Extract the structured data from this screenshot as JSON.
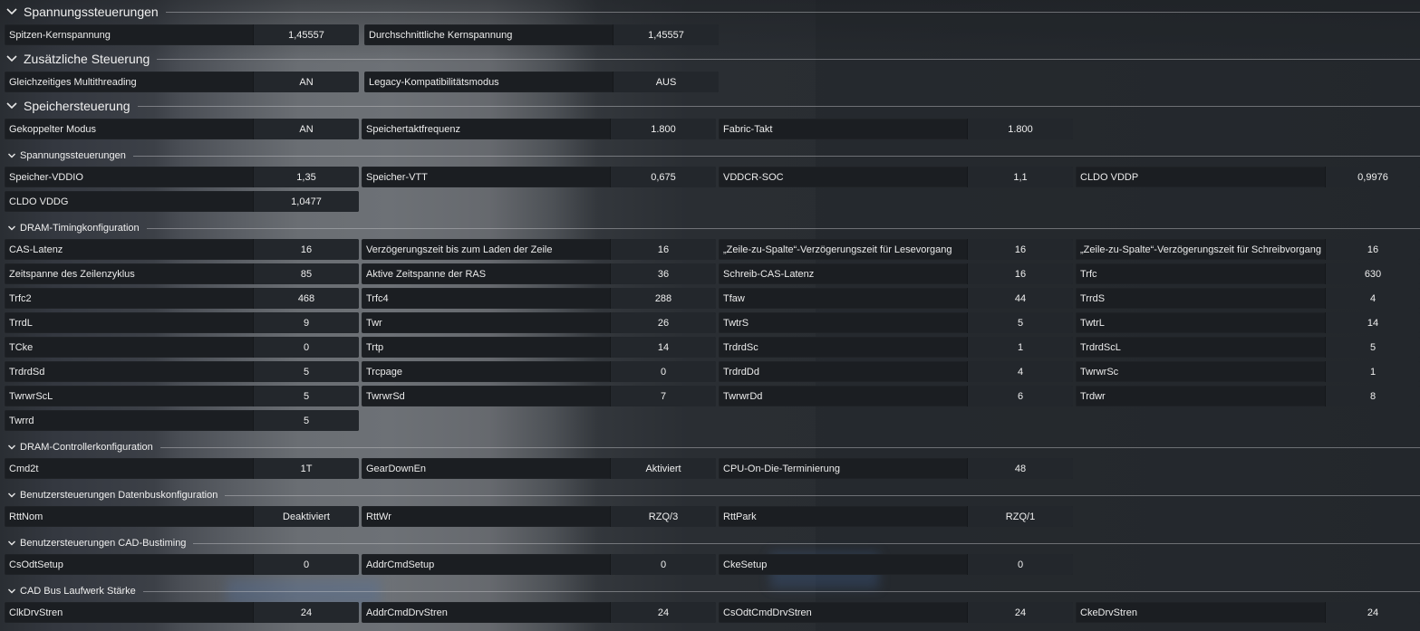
{
  "sections": {
    "s1": {
      "title": "Spannungssteuerungen"
    },
    "s2": {
      "title": "Zusätzliche Steuerung"
    },
    "s3": {
      "title": "Speichersteuerung"
    },
    "s4": {
      "title": "Spannungssteuerungen"
    },
    "s5": {
      "title": "DRAM-Timingkonfiguration"
    },
    "s6": {
      "title": "DRAM-Controllerkonfiguration"
    },
    "s7": {
      "title": "Benutzersteuerungen Datenbuskonfiguration"
    },
    "s8": {
      "title": "Benutzersteuerungen CAD-Bustiming"
    },
    "s9": {
      "title": "CAD Bus Laufwerk Stärke"
    }
  },
  "rows": {
    "peak_core_voltage": {
      "label": "Spitzen-Kernspannung",
      "value": "1,45557"
    },
    "avg_core_voltage": {
      "label": "Durchschnittliche Kernspannung",
      "value": "1,45557"
    },
    "smt": {
      "label": "Gleichzeitiges Multithreading",
      "value": "AN"
    },
    "legacy": {
      "label": "Legacy-Kompatibilitätsmodus",
      "value": "AUS"
    },
    "coupled": {
      "label": "Gekoppelter Modus",
      "value": "AN"
    },
    "mem_clock": {
      "label": "Speichertaktfrequenz",
      "value": "1.800"
    },
    "fabric": {
      "label": "Fabric-Takt",
      "value": "1.800"
    },
    "vddio": {
      "label": "Speicher-VDDIO",
      "value": "1,35"
    },
    "vtt": {
      "label": "Speicher-VTT",
      "value": "0,675"
    },
    "vddcr": {
      "label": "VDDCR-SOC",
      "value": "1,1"
    },
    "vddp": {
      "label": "CLDO VDDP",
      "value": "0,9976"
    },
    "vddg": {
      "label": "CLDO VDDG",
      "value": "1,0477"
    },
    "cas": {
      "label": "CAS-Latenz",
      "value": "16"
    },
    "rcd_load": {
      "label": "Verzögerungszeit bis zum Laden der Zeile",
      "value": "16"
    },
    "rcd_read": {
      "label": "„Zeile-zu-Spalte“-Verzögerungszeit für Lesevorgang",
      "value": "16"
    },
    "rcd_write": {
      "label": "„Zeile-zu-Spalte“-Verzögerungszeit für Schreibvorgang",
      "value": "16"
    },
    "trc": {
      "label": "Zeitspanne des Zeilenzyklus",
      "value": "85"
    },
    "tras": {
      "label": "Aktive Zeitspanne der RAS",
      "value": "36"
    },
    "wcl": {
      "label": "Schreib-CAS-Latenz",
      "value": "16"
    },
    "trfc": {
      "label": "Trfc",
      "value": "630"
    },
    "trfc2": {
      "label": "Trfc2",
      "value": "468"
    },
    "trfc4": {
      "label": "Trfc4",
      "value": "288"
    },
    "tfaw": {
      "label": "Tfaw",
      "value": "44"
    },
    "trrds": {
      "label": "TrrdS",
      "value": "4"
    },
    "trrdl": {
      "label": "TrrdL",
      "value": "9"
    },
    "twr": {
      "label": "Twr",
      "value": "26"
    },
    "twtrs": {
      "label": "TwtrS",
      "value": "5"
    },
    "twtrl": {
      "label": "TwtrL",
      "value": "14"
    },
    "tcke": {
      "label": "TCke",
      "value": "0"
    },
    "trtp": {
      "label": "Trtp",
      "value": "14"
    },
    "trdrdsc": {
      "label": "TrdrdSc",
      "value": "1"
    },
    "trdrdscl": {
      "label": "TrdrdScL",
      "value": "5"
    },
    "trdrdsd": {
      "label": "TrdrdSd",
      "value": "5"
    },
    "trcpage": {
      "label": "Trcpage",
      "value": "0"
    },
    "trdrddd": {
      "label": "TrdrdDd",
      "value": "4"
    },
    "twrwrsc": {
      "label": "TwrwrSc",
      "value": "1"
    },
    "twrwrscl": {
      "label": "TwrwrScL",
      "value": "5"
    },
    "twrwrsd": {
      "label": "TwrwrSd",
      "value": "7"
    },
    "twrwrdd": {
      "label": "TwrwrDd",
      "value": "6"
    },
    "trdwr": {
      "label": "Trdwr",
      "value": "8"
    },
    "twrrd": {
      "label": "Twrrd",
      "value": "5"
    },
    "cmd2t": {
      "label": "Cmd2t",
      "value": "1T"
    },
    "geardown": {
      "label": "GearDownEn",
      "value": "Aktiviert"
    },
    "odt": {
      "label": "CPU-On-Die-Terminierung",
      "value": "48"
    },
    "rttnom": {
      "label": "RttNom",
      "value": "Deaktiviert"
    },
    "rttwr": {
      "label": "RttWr",
      "value": "RZQ/3"
    },
    "rttpark": {
      "label": "RttPark",
      "value": "RZQ/1"
    },
    "csodtsetup": {
      "label": "CsOdtSetup",
      "value": "0"
    },
    "addrcmdsetup": {
      "label": "AddrCmdSetup",
      "value": "0"
    },
    "ckesetup": {
      "label": "CkeSetup",
      "value": "0"
    },
    "clkdrvstren": {
      "label": "ClkDrvStren",
      "value": "24"
    },
    "addrcmddrvstren": {
      "label": "AddrCmdDrvStren",
      "value": "24"
    },
    "csodtcmddrvstren": {
      "label": "CsOdtCmdDrvStren",
      "value": "24"
    },
    "ckedrvstren": {
      "label": "CkeDrvStren",
      "value": "24"
    }
  },
  "icons": {
    "chevron": "chevron-down-icon"
  },
  "colors": {
    "background": "#25292e",
    "cell": "#1b1e22",
    "value_cell": "#23272c",
    "text": "#ececec"
  }
}
